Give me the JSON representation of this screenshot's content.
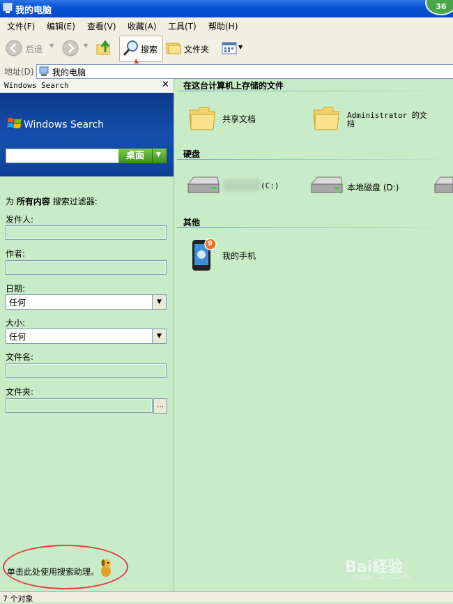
{
  "window": {
    "title": "我的电脑",
    "badge": "36"
  },
  "menu": [
    {
      "label": "文件(F)"
    },
    {
      "label": "编辑(E)"
    },
    {
      "label": "查看(V)"
    },
    {
      "label": "收藏(A)"
    },
    {
      "label": "工具(T)"
    },
    {
      "label": "帮助(H)"
    }
  ],
  "toolbar": {
    "back": "后退",
    "search": "搜索",
    "folders": "文件夹"
  },
  "address": {
    "label": "地址(D)",
    "value": "我的电脑"
  },
  "search_pane": {
    "title": "Windows Search",
    "logo_text": "Windows Search",
    "scope_button": "桌面",
    "filter_prefix": "为",
    "filter_scope": "所有内容",
    "filter_suffix": "搜索过滤器:",
    "sender_label": "发件人:",
    "author_label": "作者:",
    "date_label": "日期:",
    "date_value": "任何",
    "size_label": "大小:",
    "size_value": "任何",
    "filename_label": "文件名:",
    "folder_label": "文件夹:",
    "browse_button": "...",
    "assistant_link": "单击此处使用搜索助理。"
  },
  "right": {
    "section_files": "在这台计算机上存储的文件",
    "shared_docs": "共享文档",
    "admin_docs_line1": "Administrator 的文",
    "admin_docs_line2": "档",
    "section_drives": "硬盘",
    "drive_c": "(C:)",
    "drive_d": "本地磁盘 (D:)",
    "section_other": "其他",
    "phone": "我的手机",
    "phone_badge": "9"
  },
  "status": {
    "text": "7 个对象"
  },
  "watermark": {
    "brand": "Bai経验",
    "url": "jingyan.baidu.com"
  },
  "colors": {
    "background": "#c8ebc8",
    "titlebar": "#0a55d6",
    "accent_arrow": "#e03c3c"
  }
}
